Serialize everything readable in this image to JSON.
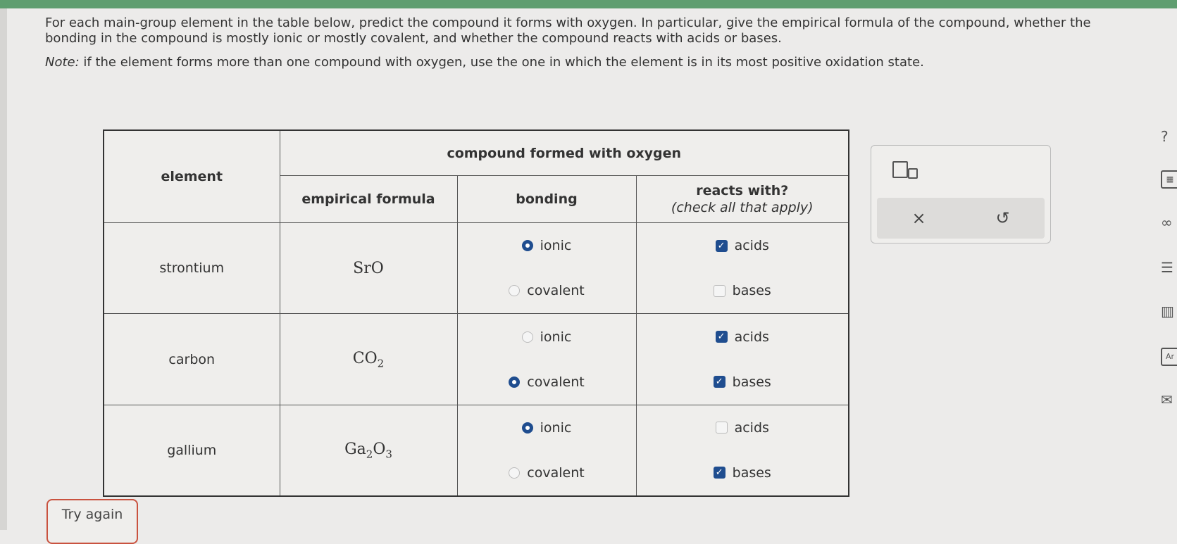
{
  "instructions": {
    "paragraph1": "For each main-group element in the table below, predict the compound it forms with oxygen. In particular, give the empirical formula of the compound, whether the bonding in the compound is mostly ionic or mostly covalent, and whether the compound reacts with acids or bases.",
    "note_label": "Note:",
    "note_text": " if the element forms more than one compound with oxygen, use the one in which the element is in its most positive oxidation state."
  },
  "table": {
    "header_element": "element",
    "header_compound": "compound formed with oxygen",
    "header_formula": "empirical formula",
    "header_bonding": "bonding",
    "header_reacts": "reacts with?",
    "header_reacts_sub": "(check all that apply)",
    "option_ionic": "ionic",
    "option_covalent": "covalent",
    "option_acids": "acids",
    "option_bases": "bases",
    "rows": [
      {
        "element": "strontium",
        "formula_parts": [
          "Sr",
          "O"
        ],
        "bonding": "ionic",
        "acids": true,
        "bases": false
      },
      {
        "element": "carbon",
        "formula_parts": [
          "C",
          "O",
          "2"
        ],
        "bonding": "covalent",
        "acids": true,
        "bases": true
      },
      {
        "element": "gallium",
        "formula_parts": [
          "Ga",
          "2",
          "O",
          "3"
        ],
        "bonding": "ionic",
        "acids": false,
        "bases": true
      }
    ]
  },
  "tool_panel": {
    "superscript_icon": "superscript-box-icon",
    "clear_symbol": "×",
    "undo_symbol": "↺"
  },
  "try_again": "Try again",
  "side_tools": [
    "help-icon",
    "calculator-icon",
    "infinity-icon",
    "reference-icon",
    "chart-icon",
    "periodic-table-icon",
    "mail-icon"
  ],
  "side_text": {
    "help": "?",
    "periodic": "Ar"
  },
  "colors": {
    "accent": "#1f4d8f",
    "topbar": "#5f9e70",
    "try_again_border": "#c9523f"
  }
}
